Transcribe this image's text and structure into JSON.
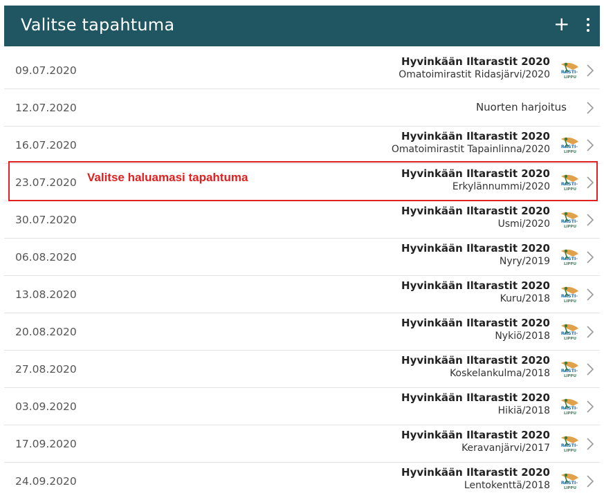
{
  "appbar": {
    "title": "Valitse tapahtuma",
    "add_label": "+",
    "add_icon": "plus-icon",
    "more_icon": "more-vertical-icon",
    "background": "#1f5662"
  },
  "callout": {
    "text": "Valitse haluamasi tapahtuma",
    "color": "#e02020"
  },
  "events": [
    {
      "date": "09.07.2020",
      "title": "Hyvinkään Iltarastit 2020",
      "subtitle": "Omatoimirastit Ridasjärvi/2020",
      "logo": "rastilippu"
    },
    {
      "date": "12.07.2020",
      "title": "",
      "subtitle": "Nuorten harjoitus",
      "logo": ""
    },
    {
      "date": "16.07.2020",
      "title": "Hyvinkään Iltarastit 2020",
      "subtitle": "Omatoimirastit Tapainlinna/2020",
      "logo": "rastilippu"
    },
    {
      "date": "23.07.2020",
      "title": "Hyvinkään Iltarastit 2020",
      "subtitle": "Erkylännummi/2020",
      "logo": "rastilippu"
    },
    {
      "date": "30.07.2020",
      "title": "Hyvinkään Iltarastit 2020",
      "subtitle": "Usmi/2020",
      "logo": "rastilippu"
    },
    {
      "date": "06.08.2020",
      "title": "Hyvinkään Iltarastit 2020",
      "subtitle": "Nyry/2019",
      "logo": "rastilippu"
    },
    {
      "date": "13.08.2020",
      "title": "Hyvinkään Iltarastit 2020",
      "subtitle": "Kuru/2018",
      "logo": "rastilippu"
    },
    {
      "date": "20.08.2020",
      "title": "Hyvinkään Iltarastit 2020",
      "subtitle": "Nykiö/2018",
      "logo": "rastilippu"
    },
    {
      "date": "27.08.2020",
      "title": "Hyvinkään Iltarastit 2020",
      "subtitle": "Koskelankulma/2018",
      "logo": "rastilippu"
    },
    {
      "date": "03.09.2020",
      "title": "Hyvinkään Iltarastit 2020",
      "subtitle": "Hikiä/2018",
      "logo": "rastilippu"
    },
    {
      "date": "17.09.2020",
      "title": "Hyvinkään Iltarastit 2020",
      "subtitle": "Keravanjärvi/2017",
      "logo": "rastilippu"
    },
    {
      "date": "24.09.2020",
      "title": "Hyvinkään Iltarastit 2020",
      "subtitle": "Lentokenttä/2018",
      "logo": "rastilippu"
    }
  ],
  "logo_text": "RASTI-LIPPU"
}
